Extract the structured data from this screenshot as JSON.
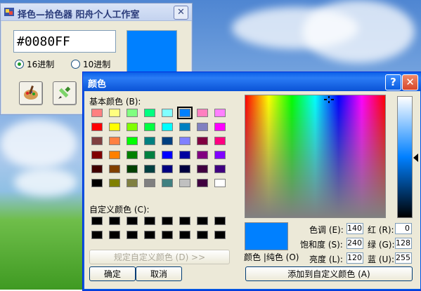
{
  "picker": {
    "title": "择色—拾色器   阳舟个人工作室",
    "hex_value": "#0080FF",
    "preview_color": "#0080ff",
    "radio_16": "16进制",
    "radio_10": "10进制",
    "tool1_icon": "palette-icon",
    "tool2_icon": "eyedropper-icon"
  },
  "dialog": {
    "title": "颜色",
    "help_glyph": "?",
    "close_glyph": "✕",
    "basic_colors_label": "基本颜色 (B):",
    "basic_colors": [
      [
        "#ff8080",
        "#ffff80",
        "#80ff80",
        "#00ff80",
        "#80ffff",
        "#0080ff",
        "#ff80c0",
        "#ff80ff"
      ],
      [
        "#ff0000",
        "#ffff00",
        "#80ff00",
        "#00ff40",
        "#00ffff",
        "#0080c0",
        "#8080c0",
        "#ff00ff"
      ],
      [
        "#804040",
        "#ff8040",
        "#00ff00",
        "#008080",
        "#004080",
        "#8080ff",
        "#800040",
        "#ff0080"
      ],
      [
        "#800000",
        "#ff8000",
        "#008000",
        "#008040",
        "#0000ff",
        "#0000a0",
        "#800080",
        "#8000ff"
      ],
      [
        "#400000",
        "#804000",
        "#004000",
        "#004040",
        "#000080",
        "#000040",
        "#400040",
        "#400080"
      ],
      [
        "#000000",
        "#808000",
        "#808040",
        "#808080",
        "#408080",
        "#c0c0c0",
        "#400040",
        "#ffffff"
      ]
    ],
    "custom_colors_label": "自定义颜色 (C):",
    "custom_colors": [
      [
        "#000000",
        "#000000",
        "#000000",
        "#000000",
        "#000000",
        "#000000",
        "#000000",
        "#000000"
      ],
      [
        "#000000",
        "#000000",
        "#000000",
        "#000000",
        "#000000",
        "#000000",
        "#000000",
        "#000000"
      ]
    ],
    "define_custom_button": "规定自定义颜色 (D) >>",
    "ok_button": "确定",
    "cancel_button": "取消",
    "color_solid_label": "颜色 |纯色 (O)",
    "current_color": "#0080ff",
    "fields": {
      "hue_label": "色调 (E):",
      "hue": "140",
      "sat_label": "饱和度 (S):",
      "sat": "240",
      "lum_label": "亮度 (L):",
      "lum": "120",
      "red_label": "红 (R):",
      "red": "0",
      "green_label": "绿 (G):",
      "green": "128",
      "blue_label": "蓝 (U):",
      "blue": "255"
    },
    "add_custom_button": "添加到自定义颜色 (A)"
  }
}
